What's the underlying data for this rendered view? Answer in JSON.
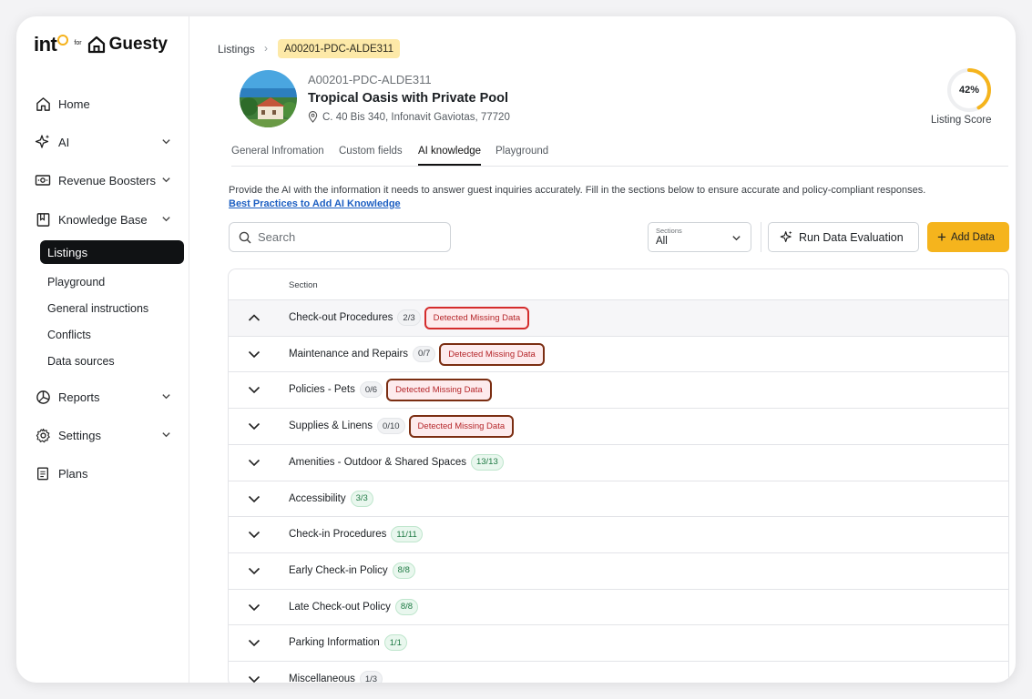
{
  "brand": {
    "name_part1": "int",
    "for_text": "for",
    "partner": "Guesty",
    "accent": "#f5b21c"
  },
  "sidebar": {
    "nav": [
      {
        "label": "Home",
        "icon": "home-icon",
        "has_chevron": false
      },
      {
        "label": "AI",
        "icon": "sparkle-icon",
        "has_chevron": true
      },
      {
        "label": "Revenue Boosters",
        "icon": "banknote-icon",
        "has_chevron": true
      },
      {
        "label": "Knowledge Base",
        "icon": "book-icon",
        "has_chevron": true
      }
    ],
    "kb_sub": {
      "active": "Listings",
      "items": [
        "Playground",
        "General instructions",
        "Conflicts",
        "Data sources"
      ]
    },
    "nav_bottom": [
      {
        "label": "Reports",
        "icon": "pie-chart-icon",
        "has_chevron": true
      },
      {
        "label": "Settings",
        "icon": "gear-icon",
        "has_chevron": true
      },
      {
        "label": "Plans",
        "icon": "clipboard-icon",
        "has_chevron": false
      }
    ]
  },
  "breadcrumb": {
    "root": "Listings",
    "current": "A00201-PDC-ALDE311"
  },
  "listing": {
    "code": "A00201-PDC-ALDE311",
    "name": "Tropical Oasis with Private Pool",
    "address": "C. 40 Bis 340, Infonavit Gaviotas, 77720"
  },
  "score": {
    "value": "42%",
    "fraction": 0.42,
    "label": "Listing Score",
    "color": "#f5b41d"
  },
  "tabs": [
    {
      "label": "General Infromation",
      "active": false
    },
    {
      "label": "Custom fields",
      "active": false
    },
    {
      "label": "AI knowledge",
      "active": true
    },
    {
      "label": "Playground",
      "active": false
    }
  ],
  "intro": {
    "text": "Provide the AI with the information it needs to answer guest inquiries accurately. Fill in the sections below to ensure accurate and policy-compliant responses.",
    "link": "Best Practices to Add AI Knowledge"
  },
  "toolbar": {
    "search_placeholder": "Search",
    "sections_label": "Sections",
    "sections_value": "All",
    "evaluate_label": "Run Data Evaluation",
    "add_label": "Add Data"
  },
  "table": {
    "header": "Section",
    "missing_label": "Detected Missing Data",
    "rows": [
      {
        "section": "Check-out Procedures",
        "count": "2/3",
        "complete": false,
        "missing": true,
        "expanded": true
      },
      {
        "section": "Maintenance and Repairs",
        "count": "0/7",
        "complete": false,
        "missing": true,
        "expanded": false
      },
      {
        "section": "Policies - Pets",
        "count": "0/6",
        "complete": false,
        "missing": true,
        "expanded": false
      },
      {
        "section": "Supplies & Linens",
        "count": "0/10",
        "complete": false,
        "missing": true,
        "expanded": false
      },
      {
        "section": "Amenities - Outdoor & Shared Spaces",
        "count": "13/13",
        "complete": true,
        "missing": false,
        "expanded": false
      },
      {
        "section": "Accessibility",
        "count": "3/3",
        "complete": true,
        "missing": false,
        "expanded": false
      },
      {
        "section": "Check-in Procedures",
        "count": "11/11",
        "complete": true,
        "missing": false,
        "expanded": false
      },
      {
        "section": "Early Check-in Policy",
        "count": "8/8",
        "complete": true,
        "missing": false,
        "expanded": false
      },
      {
        "section": "Late Check-out Policy",
        "count": "8/8",
        "complete": true,
        "missing": false,
        "expanded": false
      },
      {
        "section": "Parking Information",
        "count": "1/1",
        "complete": true,
        "missing": false,
        "expanded": false
      },
      {
        "section": "Miscellaneous",
        "count": "1/3",
        "complete": false,
        "missing": false,
        "expanded": false
      }
    ]
  }
}
